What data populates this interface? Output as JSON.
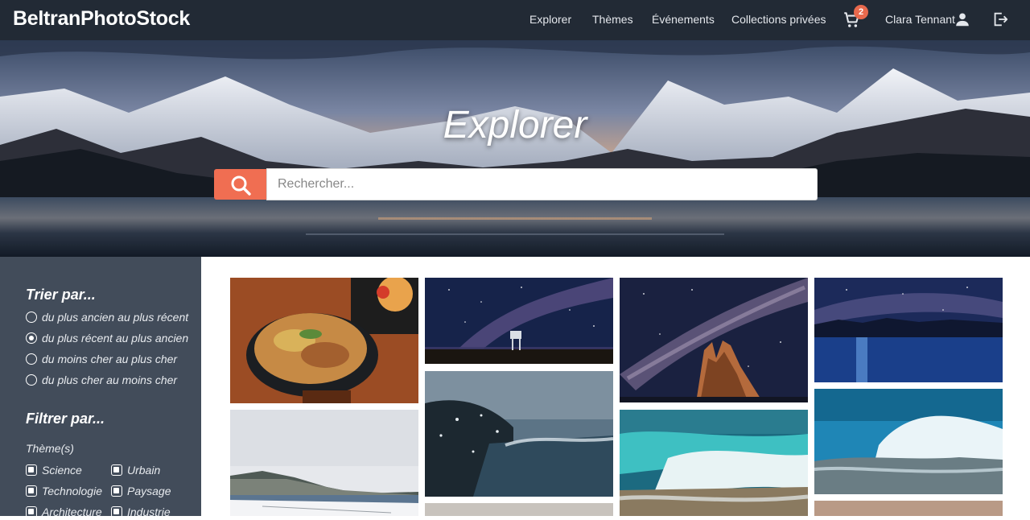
{
  "brand": "BeltranPhotoStock",
  "nav": {
    "explorer": "Explorer",
    "themes": "Thèmes",
    "events": "Événements",
    "collections": "Collections privées",
    "cart_count": "2",
    "user_name": "Clara Tennant"
  },
  "hero": {
    "title": "Explorer",
    "search_placeholder": "Rechercher..."
  },
  "sidebar": {
    "sort_heading": "Trier par...",
    "sort_options": [
      {
        "label": "du plus ancien au plus récent",
        "selected": false
      },
      {
        "label": "du plus récent au plus ancien",
        "selected": true
      },
      {
        "label": "du moins cher au plus cher",
        "selected": false
      },
      {
        "label": "du plus cher au moins cher",
        "selected": false
      }
    ],
    "filter_heading": "Filtrer par...",
    "theme_subheading": "Thème(s)",
    "themes": [
      {
        "label": "Science",
        "checked": true
      },
      {
        "label": "Urbain",
        "checked": true
      },
      {
        "label": "Technologie",
        "checked": true
      },
      {
        "label": "Paysage",
        "checked": true
      },
      {
        "label": "Architecture",
        "checked": true
      },
      {
        "label": "Industrie",
        "checked": true
      }
    ]
  },
  "gallery": {
    "photos": [
      {
        "subject": "food-bowl-photo"
      },
      {
        "subject": "beach-snow-photo"
      },
      {
        "subject": "milky-way-lifeguard-photo"
      },
      {
        "subject": "wave-rock-photo"
      },
      {
        "subject": "milky-way-rocks-photo"
      },
      {
        "subject": "turquoise-wave-photo"
      },
      {
        "subject": "night-city-water-photo"
      },
      {
        "subject": "blue-wave-splash-photo"
      }
    ]
  },
  "colors": {
    "topbar": "#222a35",
    "sidebar": "#424c5a",
    "accent": "#f06e52"
  }
}
